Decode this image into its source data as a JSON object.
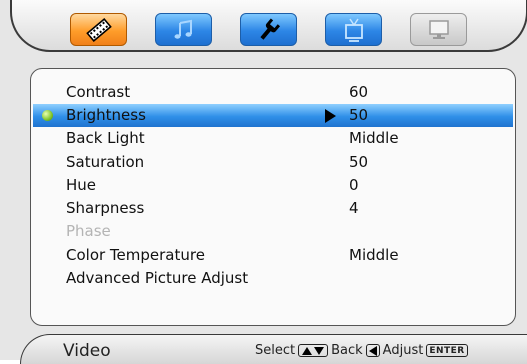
{
  "tabs": [
    {
      "icon": "film-strip-icon",
      "state": "active"
    },
    {
      "icon": "music-note-icon",
      "state": "normal"
    },
    {
      "icon": "wrench-icon",
      "state": "normal"
    },
    {
      "icon": "tv-icon",
      "state": "normal"
    },
    {
      "icon": "computer-monitor-icon",
      "state": "disabled"
    }
  ],
  "menu": {
    "items": [
      {
        "label": "Contrast",
        "value": "60"
      },
      {
        "label": "Brightness",
        "value": "50"
      },
      {
        "label": "Back Light",
        "value": "Middle"
      },
      {
        "label": "Saturation",
        "value": "50"
      },
      {
        "label": "Hue",
        "value": "0"
      },
      {
        "label": "Sharpness",
        "value": "4"
      },
      {
        "label": "Phase",
        "value": ""
      },
      {
        "label": "Color Temperature",
        "value": "Middle"
      },
      {
        "label": "Advanced Picture Adjust",
        "value": ""
      }
    ],
    "selected_index": 1,
    "disabled_index": 6
  },
  "status": {
    "mode": "Video",
    "select_label": "Select",
    "back_label": "Back",
    "adjust_label": "Adjust",
    "enter_key": "ENTER"
  },
  "colors": {
    "highlight": "#2f8fe8",
    "active_tab": "#ff9d2a",
    "tab": "#2d86e6",
    "disabled_text": "#b4b4b4"
  }
}
